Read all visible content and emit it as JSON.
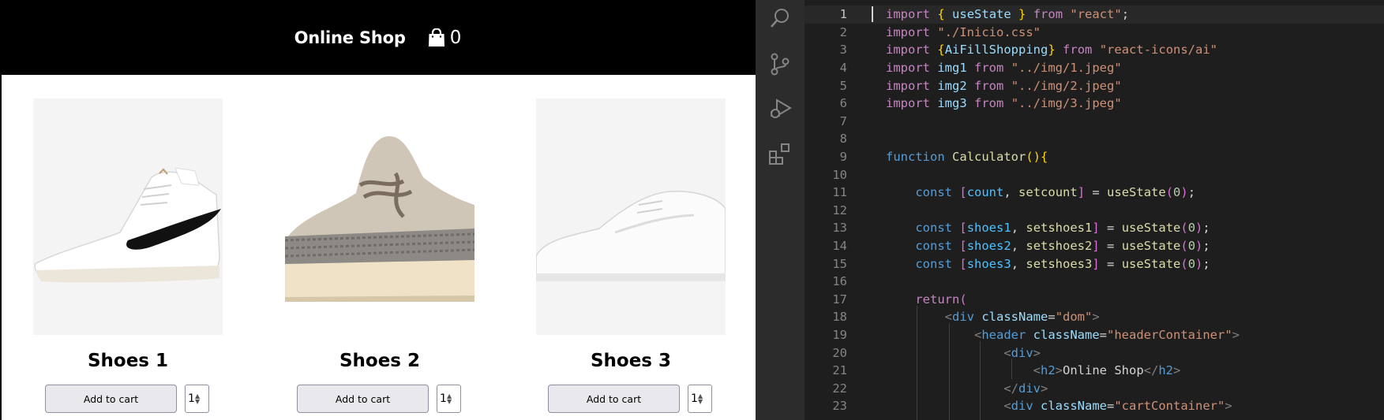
{
  "shop": {
    "title": "Online Shop",
    "cart_count": "0",
    "products": [
      {
        "name": "Shoes 1",
        "button_label": "Add to cart",
        "quantity": "1"
      },
      {
        "name": "Shoes 2",
        "button_label": "Add to cart",
        "quantity": "1"
      },
      {
        "name": "Shoes 3",
        "button_label": "Add to cart",
        "quantity": "1"
      }
    ]
  },
  "activity_bar": {
    "icons": [
      "search-icon",
      "source-control-icon",
      "run-debug-icon",
      "extensions-icon"
    ]
  },
  "editor": {
    "active_line": 1,
    "lines": [
      {
        "n": "1"
      },
      {
        "n": "2"
      },
      {
        "n": "3"
      },
      {
        "n": "4"
      },
      {
        "n": "5"
      },
      {
        "n": "6"
      },
      {
        "n": "7"
      },
      {
        "n": "8"
      },
      {
        "n": "9"
      },
      {
        "n": "10"
      },
      {
        "n": "11"
      },
      {
        "n": "12"
      },
      {
        "n": "13"
      },
      {
        "n": "14"
      },
      {
        "n": "15"
      },
      {
        "n": "16"
      },
      {
        "n": "17"
      },
      {
        "n": "18"
      },
      {
        "n": "19"
      },
      {
        "n": "20"
      },
      {
        "n": "21"
      },
      {
        "n": "22"
      },
      {
        "n": "23"
      }
    ],
    "tokens": {
      "import": "import",
      "from": "from",
      "open_brace": "{",
      "close_brace": "}",
      "useState": "useState",
      "react": "\"react\"",
      "semi": ";",
      "inicio_css": "\"./Inicio.css\"",
      "AiFillShopping": "AiFillShopping",
      "react_icons": "\"react-icons/ai\"",
      "img1": "img1",
      "img2": "img2",
      "img3": "img3",
      "img1_path": "\"../img/1.jpeg\"",
      "img2_path": "\"../img/2.jpeg\"",
      "img3_path": "\"../img/3.jpeg\"",
      "function": "function",
      "Calculator": "Calculator",
      "parens": "()",
      "const": "const",
      "open_bracket": "[",
      "close_bracket": "]",
      "count": "count",
      "setcount": "setcount",
      "shoes1": "shoes1",
      "setshoes1": "setshoes1",
      "shoes2": "shoes2",
      "setshoes2": "setshoes2",
      "shoes3": "shoes3",
      "setshoes3": "setshoes3",
      "comma": ", ",
      "equals": " = ",
      "open_paren": "(",
      "close_paren": ")",
      "zero": "0",
      "return": "return",
      "lt": "<",
      "gt": ">",
      "lt_slash": "</",
      "div": "div",
      "header": "header",
      "h2": "h2",
      "className": "className",
      "eq": "=",
      "dom": "\"dom\"",
      "headerContainer": "\"headerContainer\"",
      "cartContainer": "\"cartContainer\"",
      "online_shop": "Online Shop"
    }
  },
  "colors": {
    "shop_header_bg": "#000000",
    "editor_bg": "#1e1e1e",
    "activity_bar_bg": "#2c2c2c",
    "button_bg": "#e9e9ed"
  }
}
